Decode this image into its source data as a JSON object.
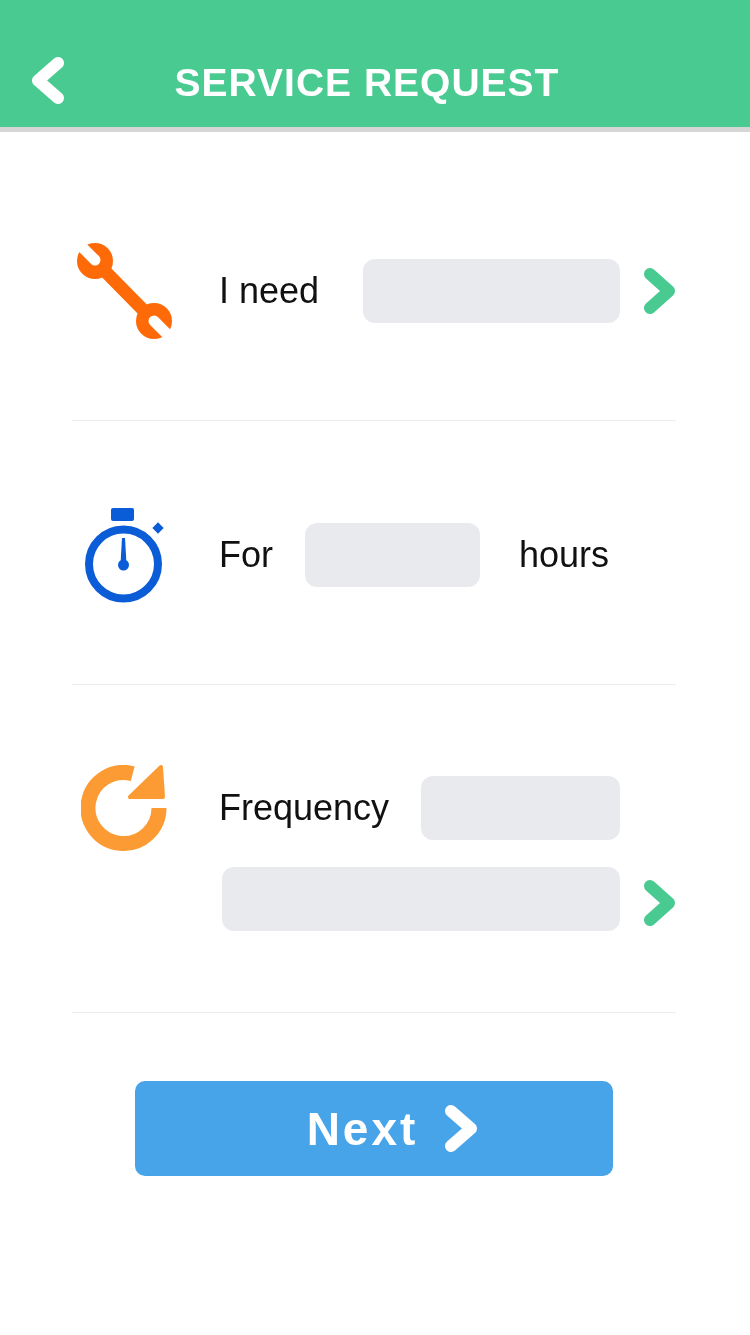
{
  "header": {
    "title": "SERVICE REQUEST"
  },
  "rows": [
    {
      "kind": "service",
      "label": "I need"
    },
    {
      "kind": "duration",
      "label": "For",
      "suffix": "hours"
    },
    {
      "kind": "frequency",
      "label": "Frequency"
    }
  ],
  "next_button": {
    "label": "Next"
  }
}
